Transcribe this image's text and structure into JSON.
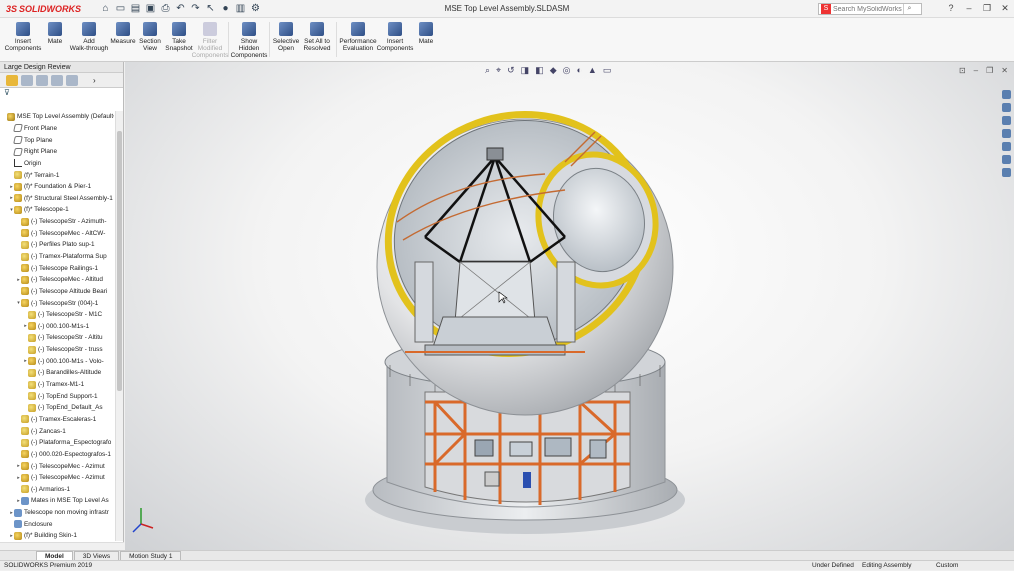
{
  "titlebar": {
    "brand": "SOLIDWORKS",
    "document_title": "MSE Top Level Assembly.SLDASM",
    "search_placeholder": "Search MySolidWorks"
  },
  "ribbon": {
    "buttons": [
      {
        "label": "Insert\nComponents"
      },
      {
        "label": "Mate"
      },
      {
        "label": "Add\nWalk-through"
      },
      {
        "label": "Measure"
      },
      {
        "label": "Section\nView"
      },
      {
        "label": "Take\nSnapshot"
      },
      {
        "label": "Filter\nModified\nComponents",
        "disabled": true
      },
      {
        "label": "Show\nHidden\nComponents"
      },
      {
        "label": "Selective\nOpen"
      },
      {
        "label": "Set All to\nResolved"
      },
      {
        "label": "Performance\nEvaluation"
      },
      {
        "label": "Insert\nComponents"
      },
      {
        "label": "Mate"
      }
    ]
  },
  "left_pane": {
    "title": "Large Design Review",
    "tree": [
      {
        "label": "MSE Top Level Assembly  (Default<Dis",
        "icon": "root",
        "indent": 0,
        "toggle": ""
      },
      {
        "label": "Front Plane",
        "icon": "plane",
        "indent": 1,
        "toggle": ""
      },
      {
        "label": "Top Plane",
        "icon": "plane",
        "indent": 1,
        "toggle": ""
      },
      {
        "label": "Right Plane",
        "icon": "plane",
        "indent": 1,
        "toggle": ""
      },
      {
        "label": "Origin",
        "icon": "origin",
        "indent": 1,
        "toggle": ""
      },
      {
        "label": "(f)* Terrain-1",
        "icon": "part",
        "indent": 1,
        "toggle": ""
      },
      {
        "label": "(f)* Foundation & Pier-1",
        "icon": "asm",
        "indent": 1,
        "toggle": "▸"
      },
      {
        "label": "(f)* Structural Steel Assembly-1",
        "icon": "asm",
        "indent": 1,
        "toggle": "▸"
      },
      {
        "label": "(f)* Telescope-1",
        "icon": "asm",
        "indent": 1,
        "toggle": "▾"
      },
      {
        "label": "(-) TelescopeStr - Azimuth-",
        "icon": "asm",
        "indent": 2,
        "toggle": ""
      },
      {
        "label": "(-) TelescopeMec - AltCW-",
        "icon": "asm",
        "indent": 2,
        "toggle": ""
      },
      {
        "label": "(-) Perfiles Plato sup-1",
        "icon": "part",
        "indent": 2,
        "toggle": ""
      },
      {
        "label": "(-) Tramex-Plataforma Sup",
        "icon": "part",
        "indent": 2,
        "toggle": ""
      },
      {
        "label": "(-) Telescope Railings-1",
        "icon": "asm",
        "indent": 2,
        "toggle": ""
      },
      {
        "label": "(-) TelescopeMec - Altitud",
        "icon": "asm",
        "indent": 2,
        "toggle": "▸"
      },
      {
        "label": "(-) Telescope Altitude Beari",
        "icon": "asm",
        "indent": 2,
        "toggle": ""
      },
      {
        "label": "(-) TelescopeStr (004)-1",
        "icon": "asm",
        "indent": 2,
        "toggle": "▾"
      },
      {
        "label": "(-) TelescopeStr - M1C",
        "icon": "part",
        "indent": 3,
        "toggle": ""
      },
      {
        "label": "(-) 000.100-M1s-1",
        "icon": "asm",
        "indent": 3,
        "toggle": "▸"
      },
      {
        "label": "(-) TelescopeStr - Altitu",
        "icon": "part",
        "indent": 3,
        "toggle": ""
      },
      {
        "label": "(-) TelescopeStr - truss",
        "icon": "part",
        "indent": 3,
        "toggle": ""
      },
      {
        "label": "(-) 000.100-M1s - Volo-",
        "icon": "asm",
        "indent": 3,
        "toggle": "▸"
      },
      {
        "label": "(-) Barandilles-Altitude",
        "icon": "part",
        "indent": 3,
        "toggle": ""
      },
      {
        "label": "(-) Tramex-M1-1",
        "icon": "part",
        "indent": 3,
        "toggle": ""
      },
      {
        "label": "(-) TopEnd Support-1",
        "icon": "part",
        "indent": 3,
        "toggle": ""
      },
      {
        "label": "(-) TopEnd_Default_As",
        "icon": "part",
        "indent": 3,
        "toggle": ""
      },
      {
        "label": "(-) Tramex-Escaleras-1",
        "icon": "part",
        "indent": 2,
        "toggle": ""
      },
      {
        "label": "(-) Zancas-1",
        "icon": "part",
        "indent": 2,
        "toggle": ""
      },
      {
        "label": "(-) Plataforma_Espectografo",
        "icon": "part",
        "indent": 2,
        "toggle": ""
      },
      {
        "label": "(-) 000.020-Espectografos-1",
        "icon": "asm",
        "indent": 2,
        "toggle": ""
      },
      {
        "label": "(-) TelescopeMec - Azimut",
        "icon": "asm",
        "indent": 2,
        "toggle": "▸"
      },
      {
        "label": "(-) TelescopeMec - Azimut",
        "icon": "asm",
        "indent": 2,
        "toggle": "▸"
      },
      {
        "label": "(-) Armarios-1",
        "icon": "part",
        "indent": 2,
        "toggle": ""
      },
      {
        "label": "Mates in MSE Top Level As",
        "icon": "folder",
        "indent": 2,
        "toggle": "▸"
      },
      {
        "label": "Telescope non moving infrastr",
        "icon": "folder",
        "indent": 1,
        "toggle": "▸"
      },
      {
        "label": "Enclosure",
        "icon": "folder",
        "indent": 1,
        "toggle": ""
      },
      {
        "label": "(f)* Building Skin-1",
        "icon": "asm",
        "indent": 1,
        "toggle": "▸"
      }
    ]
  },
  "bottom_tabs": [
    "Model",
    "3D Views",
    "Motion Study 1"
  ],
  "statusbar": {
    "product": "SOLIDWORKS Premium 2019",
    "state": "Under Defined",
    "mode": "Editing Assembly",
    "units": "Custom"
  }
}
